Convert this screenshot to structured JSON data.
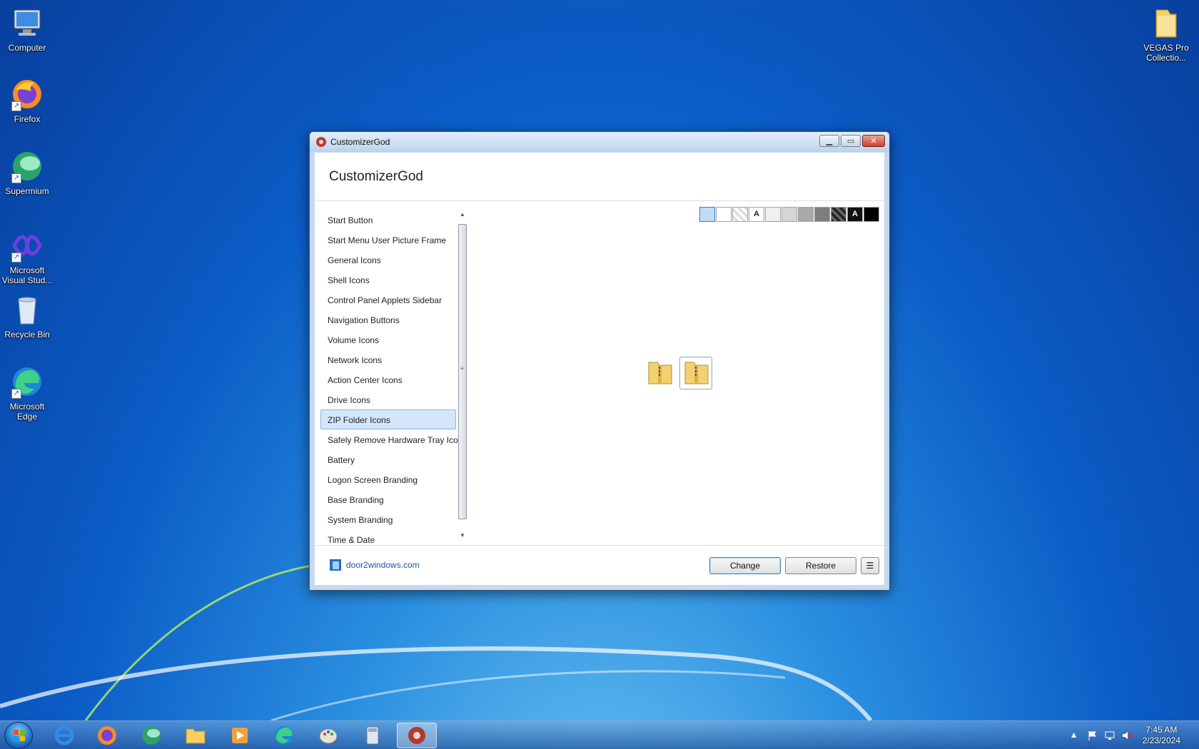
{
  "desktop": {
    "icons": [
      {
        "label": "Computer"
      },
      {
        "label": "Firefox"
      },
      {
        "label": "Supermium"
      },
      {
        "label": "Microsoft Visual Stud..."
      },
      {
        "label": "Recycle Bin"
      },
      {
        "label": "Microsoft Edge"
      },
      {
        "label": "VEGAS Pro Collectio..."
      }
    ]
  },
  "window": {
    "title": "CustomizerGod",
    "header": "CustomizerGod",
    "nav": [
      "Start Button",
      "Start Menu User Picture Frame",
      "General Icons",
      "Shell Icons",
      "Control Panel Applets Sidebar",
      "Navigation Buttons",
      "Volume Icons",
      "Network Icons",
      "Action Center Icons",
      "Drive Icons",
      "ZIP Folder Icons",
      "Safely Remove Hardware Tray Icon",
      "Battery",
      "Logon Screen Branding",
      "Base Branding",
      "System Branding",
      "Time & Date"
    ],
    "selected_nav": "ZIP Folder Icons",
    "swatch_letter": "A",
    "footer_link": "door2windows.com",
    "buttons": {
      "change": "Change",
      "restore": "Restore",
      "menu": "☰"
    }
  },
  "taskbar": {
    "time": "7:45 AM",
    "date": "2/23/2024"
  },
  "colors": {
    "selected_bg": "#d4e6fb",
    "link": "#1f55a8"
  }
}
